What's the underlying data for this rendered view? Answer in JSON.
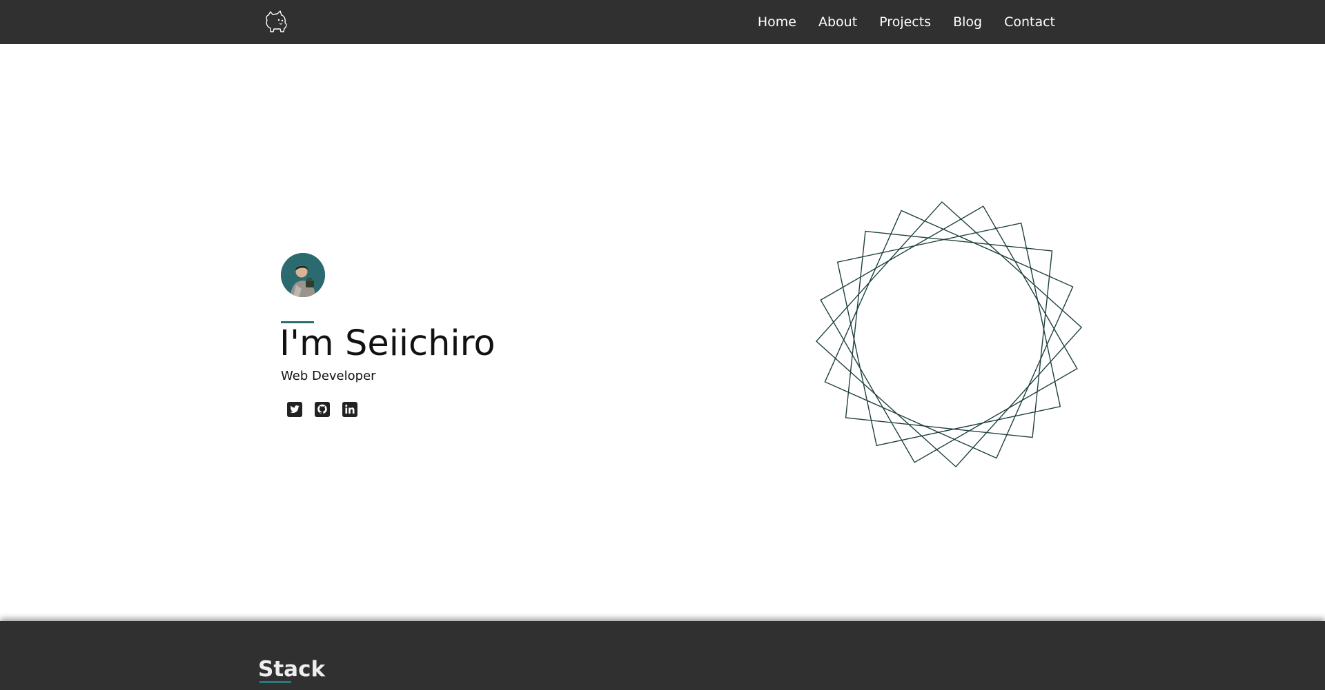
{
  "nav": {
    "logo_icon": "cat-logo-icon",
    "items": [
      {
        "label": "Home"
      },
      {
        "label": "About"
      },
      {
        "label": "Projects"
      },
      {
        "label": "Blog"
      },
      {
        "label": "Contact"
      }
    ]
  },
  "hero": {
    "avatar_icon": "avatar-photo",
    "title": "I'm Seiichiro",
    "subtitle": "Web Developer",
    "socials": [
      {
        "icon": "twitter-icon"
      },
      {
        "icon": "github-icon"
      },
      {
        "icon": "linkedin-icon"
      }
    ],
    "decoration_icon": "rotated-squares-graphic"
  },
  "stack": {
    "title": "Stack"
  },
  "colors": {
    "nav_background": "#303030",
    "accent": "#2b6a6f",
    "page_background": "#ffffff",
    "text": "#111111",
    "nav_text": "#ffffff"
  }
}
